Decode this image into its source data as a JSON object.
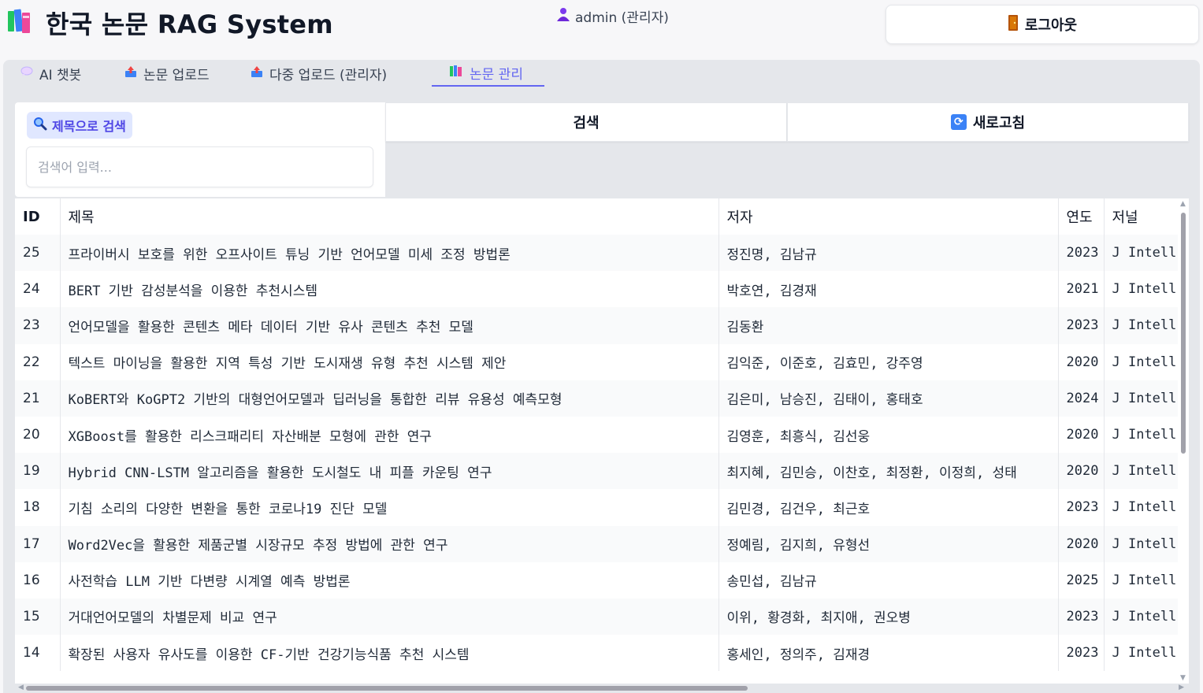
{
  "header": {
    "title": "한국 논문 RAG System",
    "user": "admin (관리자)",
    "logout_label": "로그아웃"
  },
  "tabs": [
    {
      "label": "AI 챗봇",
      "icon": "speech-bubble-icon"
    },
    {
      "label": "논문 업로드",
      "icon": "upload-icon"
    },
    {
      "label": "다중 업로드 (관리자)",
      "icon": "upload-icon"
    },
    {
      "label": "논문 관리",
      "icon": "books-icon",
      "active": true
    }
  ],
  "search": {
    "label": "제목으로 검색",
    "placeholder": "검색어 입력...",
    "value": "",
    "search_button": "검색",
    "refresh_button": "새로고침"
  },
  "table": {
    "columns": [
      "ID",
      "제목",
      "저자",
      "연도",
      "저널"
    ],
    "rows": [
      {
        "id": "25",
        "title": "프라이버시 보호를 위한 오프사이트 튜닝 기반 언어모델 미세 조정 방법론",
        "authors": "정진명, 김남규",
        "year": "2023",
        "journal": "J Intell"
      },
      {
        "id": "24",
        "title": "BERT 기반 감성분석을 이용한 추천시스템",
        "authors": "박호연, 김경재",
        "year": "2021",
        "journal": "J Intell"
      },
      {
        "id": "23",
        "title": "언어모델을 활용한 콘텐츠 메타 데이터 기반 유사 콘텐츠 추천 모델",
        "authors": "김동환",
        "year": "2023",
        "journal": "J Intell"
      },
      {
        "id": "22",
        "title": "텍스트 마이닝을 활용한 지역 특성 기반 도시재생 유형 추천 시스템 제안",
        "authors": "김익준, 이준호, 김효민, 강주영",
        "year": "2020",
        "journal": "J Intell"
      },
      {
        "id": "21",
        "title": "KoBERT와 KoGPT2 기반의 대형언어모델과 딥러닝을 통합한 리뷰 유용성 예측모형",
        "authors": "김은미, 남승진, 김태이, 홍태호",
        "year": "2024",
        "journal": "J Intell"
      },
      {
        "id": "20",
        "title": "XGBoost를 활용한 리스크패리티 자산배분 모형에 관한 연구",
        "authors": "김영훈, 최흥식, 김선웅",
        "year": "2020",
        "journal": "J Intell"
      },
      {
        "id": "19",
        "title": "Hybrid CNN-LSTM 알고리즘을 활용한 도시철도 내 피플 카운팅 연구",
        "authors": "최지혜, 김민승, 이찬호, 최정환, 이정희, 성태",
        "year": "2020",
        "journal": "J Intell"
      },
      {
        "id": "18",
        "title": "기침 소리의 다양한 변환을 통한 코로나19 진단 모델",
        "authors": "김민경, 김건우, 최근호",
        "year": "2023",
        "journal": "J Intell"
      },
      {
        "id": "17",
        "title": "Word2Vec을 활용한 제품군별 시장규모 추정 방법에 관한 연구",
        "authors": "정예림, 김지희, 유형선",
        "year": "2020",
        "journal": "J Intell"
      },
      {
        "id": "16",
        "title": "사전학습 LLM 기반 다변량 시계열 예측 방법론",
        "authors": "송민섭, 김남규",
        "year": "2025",
        "journal": "J Intell"
      },
      {
        "id": "15",
        "title": "거대언어모델의 차별문제 비교 연구",
        "authors": "이위, 황경화, 최지애, 권오병",
        "year": "2023",
        "journal": "J Intell"
      },
      {
        "id": "14",
        "title": "확장된 사용자 유사도를 이용한 CF-기반 건강기능식품 추천 시스템",
        "authors": "홍세인, 정의주, 김재경",
        "year": "2023",
        "journal": "J Intell"
      }
    ]
  },
  "colors": {
    "accent": "#6366f1",
    "panel": "#e5e7eb",
    "background": "#f7f7f9"
  }
}
